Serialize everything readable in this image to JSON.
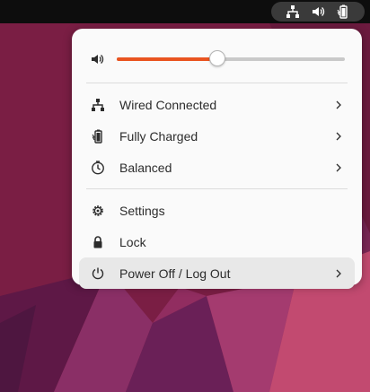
{
  "topbar": {
    "icons": [
      "network-wired-icon",
      "volume-icon",
      "battery-icon"
    ]
  },
  "volume": {
    "icon": "volume-icon",
    "level": 0.44
  },
  "menu": {
    "status_items": [
      {
        "label": "Wired Connected",
        "icon": "network-wired-icon",
        "has_submenu": true
      },
      {
        "label": "Fully Charged",
        "icon": "battery-icon",
        "has_submenu": true
      },
      {
        "label": "Balanced",
        "icon": "power-profile-icon",
        "has_submenu": true
      }
    ],
    "action_items": [
      {
        "label": "Settings",
        "icon": "gear-icon",
        "has_submenu": false
      },
      {
        "label": "Lock",
        "icon": "lock-icon",
        "has_submenu": false
      },
      {
        "label": "Power Off / Log Out",
        "icon": "power-icon",
        "has_submenu": true,
        "highlighted": true
      }
    ]
  },
  "colors": {
    "accent": "#e95420",
    "menu_bg": "#fafafa",
    "topbar_bg": "#0d0d0d"
  }
}
